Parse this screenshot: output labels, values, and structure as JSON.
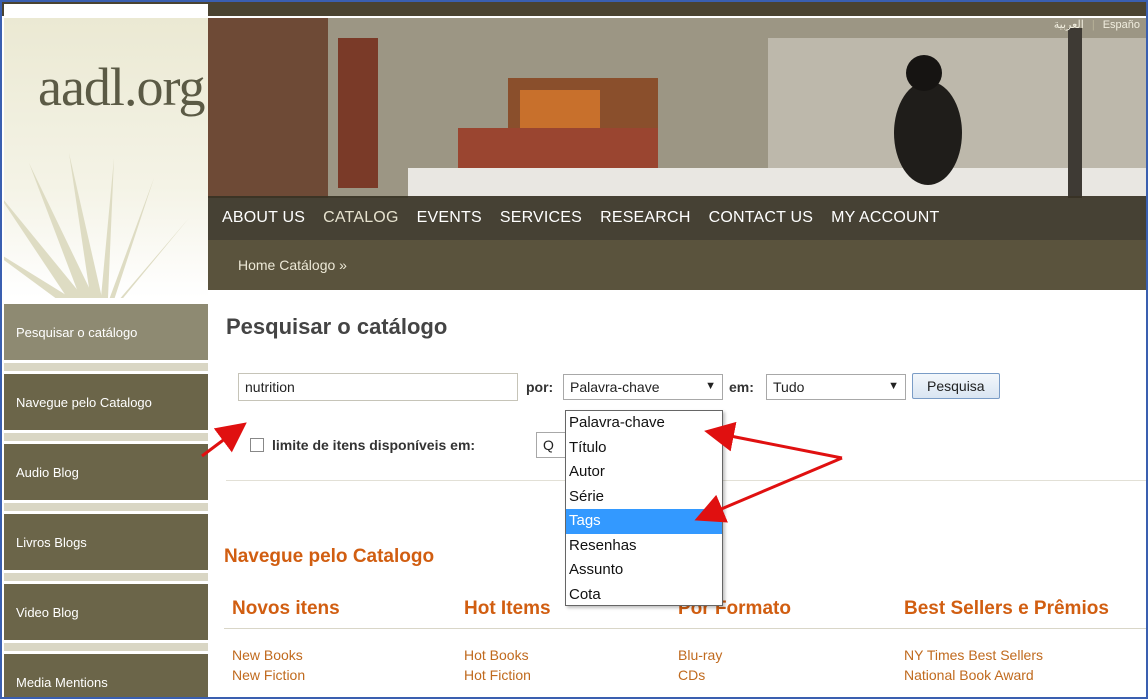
{
  "site": {
    "logo": "aadl.org"
  },
  "languages": [
    "العربية",
    "Españo"
  ],
  "nav": [
    "ABOUT US",
    "CATALOG",
    "EVENTS",
    "SERVICES",
    "RESEARCH",
    "CONTACT US",
    "MY ACCOUNT"
  ],
  "breadcrumb": "Home Catálogo »",
  "sidebar": [
    "Pesquisar o catálogo",
    "Navegue pelo Catalogo",
    "Audio Blog",
    "Livros Blogs",
    "Video Blog",
    "Media Mentions"
  ],
  "page_title": "Pesquisar o catálogo",
  "search": {
    "value": "nutrition",
    "por_label": "por:",
    "por_value": "Palavra-chave",
    "em_label": "em:",
    "em_value": "Tudo",
    "button": "Pesquisa",
    "limit_label": "limite de itens disponíveis em:",
    "limit_value": "Q"
  },
  "dropdown_options": [
    "Palavra-chave",
    "Título",
    "Autor",
    "Série",
    "Tags",
    "Resenhas",
    "Assunto",
    "Cota"
  ],
  "dropdown_selected": "Tags",
  "browse": {
    "title": "Navegue pelo Catalogo",
    "columns": [
      {
        "head": "Novos itens",
        "links": [
          "New Books",
          "New Fiction"
        ]
      },
      {
        "head": "Hot Items",
        "links": [
          "Hot Books",
          "Hot Fiction"
        ]
      },
      {
        "head": "Por Formato",
        "links": [
          "Blu-ray",
          "CDs"
        ]
      },
      {
        "head": "Best Sellers e Prêmios",
        "links": [
          "NY Times Best Sellers",
          "National Book Award"
        ]
      }
    ]
  },
  "colors": {
    "accent": "#d15e11",
    "nav_bg": "#3b3524",
    "sidebar_bg": "#6b6549",
    "highlight": "#3399ff",
    "annotation": "#e01010"
  }
}
